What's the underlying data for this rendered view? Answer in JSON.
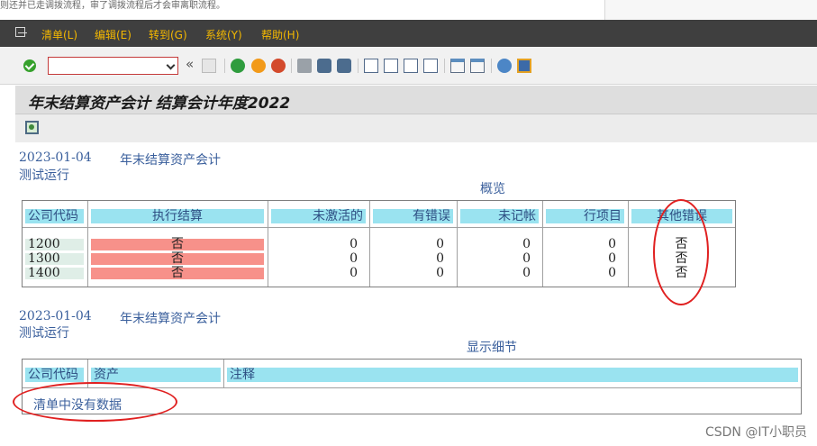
{
  "notice": "则还并已走调拨流程，审了调拨流程后才会审离职流程。",
  "menu": [
    {
      "label": "清单(L)"
    },
    {
      "label": "编辑(E)"
    },
    {
      "label": "转到(G)"
    },
    {
      "label": "系统(Y)"
    },
    {
      "label": "帮助(H)"
    }
  ],
  "toolbar": {
    "command_value": "",
    "collapse_label": "«"
  },
  "title": "年末结算资产会计 结算会计年度2022",
  "sections": [
    {
      "date": "2023-01-04",
      "subtitle": "年末结算资产会计",
      "mode": "测试运行",
      "caption": "概览",
      "columns": [
        "公司代码",
        "执行结算",
        "未激活的",
        "有错误",
        "未记帐",
        "行项目",
        "其他错误"
      ],
      "rows": [
        {
          "company": "1200",
          "execute": "否",
          "inactive": "0",
          "errors": "0",
          "unposted": "0",
          "line_items": "0",
          "other_errors": "否"
        },
        {
          "company": "1300",
          "execute": "否",
          "inactive": "0",
          "errors": "0",
          "unposted": "0",
          "line_items": "0",
          "other_errors": "否"
        },
        {
          "company": "1400",
          "execute": "否",
          "inactive": "0",
          "errors": "0",
          "unposted": "0",
          "line_items": "0",
          "other_errors": "否"
        }
      ]
    },
    {
      "date": "2023-01-04",
      "subtitle": "年末结算资产会计",
      "mode": "测试运行",
      "caption": "显示细节",
      "columns": [
        "公司代码",
        "资产",
        "注释"
      ],
      "empty": "清单中没有数据"
    }
  ],
  "watermark": "CSDN @IT小职员",
  "colors": {
    "menu_bar": "#3f3f3f",
    "menu_text": "#f4b800",
    "header_cell": "#9ae3f0",
    "execute_no": "#f7918a",
    "annotation": "#e02020",
    "text_blue": "#3a5f9c"
  },
  "icons": [
    "ok-icon",
    "save-icon",
    "back-icon",
    "exit-icon",
    "cancel-icon",
    "print-icon",
    "find-icon",
    "find-next-icon",
    "first-page-icon",
    "previous-page-icon",
    "next-page-icon",
    "last-page-icon",
    "new-session-icon",
    "shortcut-icon",
    "help-icon",
    "layout-icon",
    "detail-icon"
  ]
}
